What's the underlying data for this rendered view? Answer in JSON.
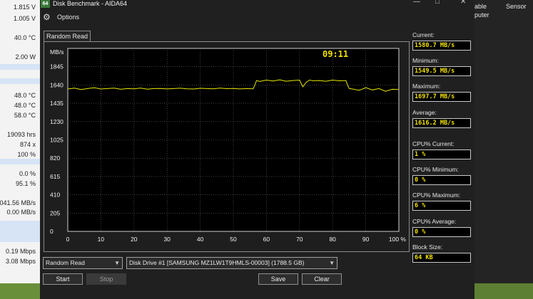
{
  "window": {
    "app_icon_text": "64",
    "title": "Disk Benchmark - AIDA64",
    "options_label": "Options"
  },
  "left_panel": {
    "values": [
      "1.815 V",
      "1.005 V",
      "40.0 °C",
      "2.00 W",
      "48.0 °C",
      "48.0 °C",
      "58.0 °C",
      "19093 hrs",
      "874 x",
      "100 %",
      "0.0 %",
      "95.1 %",
      "041.56 MB/s",
      "0.00 MB/s",
      "0.19 Mbps",
      "3.08 Mbps"
    ]
  },
  "right_panel": {
    "col1_line1": "able",
    "col1_line2": "puter",
    "col2": "Sensor"
  },
  "tab": {
    "label": "Random Read"
  },
  "chart_data": {
    "type": "line",
    "ylabel": "MB/s",
    "time_label": "09:11",
    "yticks": [
      0,
      205,
      410,
      615,
      820,
      1025,
      1230,
      1435,
      1640,
      1845
    ],
    "xticks": [
      "0",
      "10",
      "20",
      "30",
      "40",
      "50",
      "60",
      "70",
      "80",
      "90",
      "100 %"
    ],
    "xlim": [
      0,
      100
    ],
    "ylim": [
      0,
      2050
    ],
    "line_color": "#e6e600",
    "grid": true,
    "series": [
      {
        "x": [
          0,
          2,
          4,
          6,
          8,
          10,
          12,
          14,
          16,
          18,
          20,
          22,
          24,
          26,
          28,
          30,
          32,
          34,
          36,
          38,
          40,
          42,
          44,
          46,
          48,
          50,
          52,
          54,
          56,
          56.5,
          57,
          58,
          60,
          62,
          64,
          66,
          68,
          70,
          71,
          72,
          73,
          74,
          76,
          78,
          80,
          82,
          84,
          84.5,
          85,
          86,
          88,
          90,
          92,
          94,
          96,
          98,
          100
        ],
        "y": [
          1595,
          1605,
          1590,
          1600,
          1610,
          1595,
          1600,
          1605,
          1592,
          1600,
          1598,
          1606,
          1594,
          1600,
          1602,
          1596,
          1600,
          1604,
          1598,
          1595,
          1603,
          1600,
          1597,
          1605,
          1599,
          1601,
          1596,
          1600,
          1598,
          1640,
          1690,
          1680,
          1695,
          1685,
          1698,
          1682,
          1690,
          1695,
          1620,
          1670,
          1695,
          1688,
          1690,
          1682,
          1695,
          1687,
          1690,
          1640,
          1600,
          1595,
          1580,
          1610,
          1585,
          1600,
          1570,
          1592,
          1590
        ]
      }
    ]
  },
  "stats": {
    "current_label": "Current:",
    "current_value": "1580.7 MB/s",
    "minimum_label": "Minimum:",
    "minimum_value": "1549.5 MB/s",
    "maximum_label": "Maximum:",
    "maximum_value": "1697.7 MB/s",
    "average_label": "Average:",
    "average_value": "1616.2 MB/s",
    "cpu_current_label": "CPU% Current:",
    "cpu_current_value": "1 %",
    "cpu_minimum_label": "CPU% Minimum:",
    "cpu_minimum_value": "0 %",
    "cpu_maximum_label": "CPU% Maximum:",
    "cpu_maximum_value": "6 %",
    "cpu_average_label": "CPU% Average:",
    "cpu_average_value": "0 %",
    "block_size_label": "Block Size:",
    "block_size_value": "64 KB"
  },
  "controls": {
    "test_select": "Random Read",
    "drive_select": "Disk Drive #1  [SAMSUNG MZ1LW1T9HMLS-00003]  (1788.5 GB)",
    "start_label": "Start",
    "stop_label": "Stop",
    "save_label": "Save",
    "clear_label": "Clear"
  },
  "icons": [
    "options-icon",
    "dropdown-arrow-icon",
    "minimize-icon",
    "maximize-icon",
    "close-icon"
  ]
}
